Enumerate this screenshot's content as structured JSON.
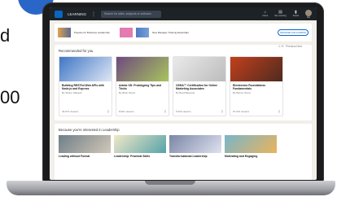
{
  "left_fragments": {
    "line1": "d",
    "line2": "00"
  },
  "app": {
    "brand": "LEARNING",
    "search_placeholder": "Search for skills, subjects or software",
    "nav": [
      {
        "icon": "home-icon",
        "label": "Home"
      },
      {
        "icon": "my-learning-icon",
        "label": "My Learning"
      },
      {
        "icon": "bookmark-icon",
        "label": "Saved"
      },
      {
        "icon": "me-icon",
        "label": "Me"
      }
    ],
    "strip": {
      "item1": "Prepare for Business Leadership",
      "item2": "New Manager Training Essentials",
      "button": "MANAGE FOLLOWING"
    },
    "recommended": {
      "title": "Recommended for you",
      "paging": "1 / 5 · Previous  Next",
      "cards": [
        {
          "title": "Building RESTful Web APIs with Node.js and Express",
          "author": "By Shaun Wassell",
          "meta": "43,574 viewers"
        },
        {
          "title": "Adobe XD: Prototyping Tips and Tricks",
          "author": "By Brian Wood",
          "meta": "8,901 viewers"
        },
        {
          "title": "OSHA™ Certification for Online Marketing Associates",
          "author": "By Brad Batesole",
          "meta": "5,632 viewers"
        },
        {
          "title": "Electronics Foundations: Fundamentals",
          "author": "By Barron Stone",
          "meta": "97,621 viewers"
        }
      ]
    },
    "leadership": {
      "title": "Because you're interested in Leadership",
      "items": [
        "Leading without Formal",
        "Leadership: Practical Skills",
        "Transformational Leadership",
        "Motivating and Engaging"
      ]
    }
  }
}
